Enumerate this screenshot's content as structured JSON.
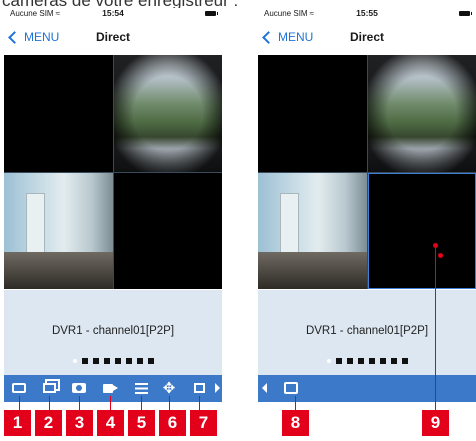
{
  "caption": "caméras de votre enregistreur :",
  "screens": [
    {
      "status": {
        "carrier": "Aucune SIM",
        "wifi_icon": "wifi-icon",
        "time": "15:54"
      },
      "nav": {
        "back_label": "MENU",
        "title": "Direct"
      },
      "channel_label": "DVR1 - channel01[P2P]"
    },
    {
      "status": {
        "carrier": "Aucune SIM",
        "wifi_icon": "wifi-icon",
        "time": "15:55"
      },
      "nav": {
        "back_label": "MENU",
        "title": "Direct"
      },
      "channel_label": "DVR1 - channel01[P2P]"
    }
  ],
  "page_indicator": {
    "pages": 8,
    "current": 1
  },
  "toolbar_a_icons": [
    "single-view-icon",
    "multi-view-icon",
    "snapshot-icon",
    "record-icon",
    "list-icon",
    "ptz-icon",
    "more-icon"
  ],
  "toolbar_b_icons": [
    "image-quality-icon"
  ],
  "callouts": [
    "1",
    "2",
    "3",
    "4",
    "5",
    "6",
    "7",
    "8",
    "9"
  ],
  "colors": {
    "accent": "#3c79c9",
    "callout": "#e2001a",
    "channel_bar": "#dde7f1",
    "back_link": "#1f73d8"
  }
}
